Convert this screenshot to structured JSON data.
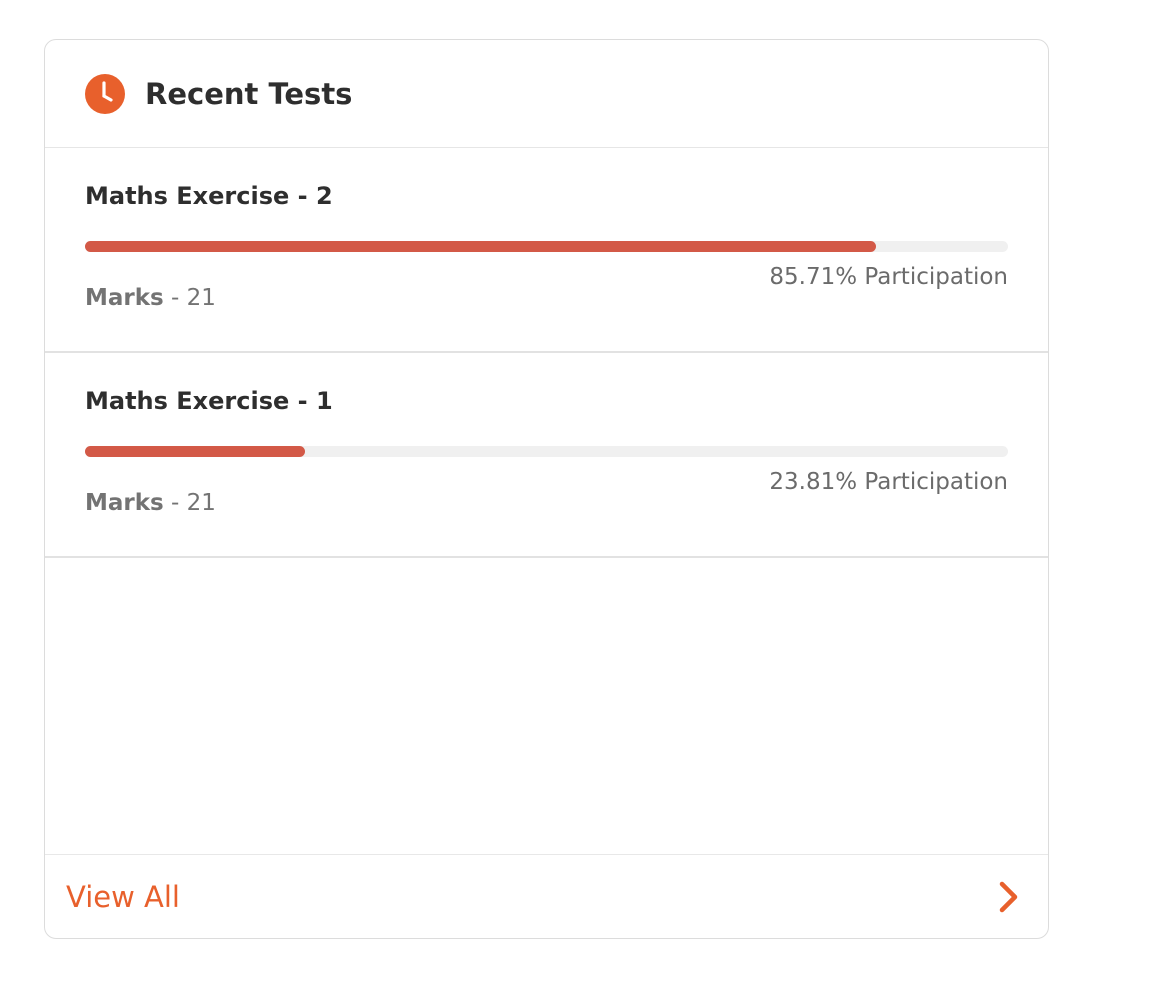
{
  "card": {
    "title": "Recent Tests",
    "header_icon": "clock-icon",
    "accent_color": "#e8602c",
    "progress_color": "#d35947"
  },
  "tests": [
    {
      "name": "Maths Exercise - 2",
      "participation_percent": 85.71,
      "participation_text": "85.71% Participation",
      "marks_label": "Marks",
      "marks_value": " - 21"
    },
    {
      "name": "Maths Exercise - 1",
      "participation_percent": 23.81,
      "participation_text": "23.81% Participation",
      "marks_label": "Marks",
      "marks_value": " - 21"
    }
  ],
  "footer": {
    "view_all_label": "View All",
    "arrow_icon": "chevron-right-icon"
  }
}
